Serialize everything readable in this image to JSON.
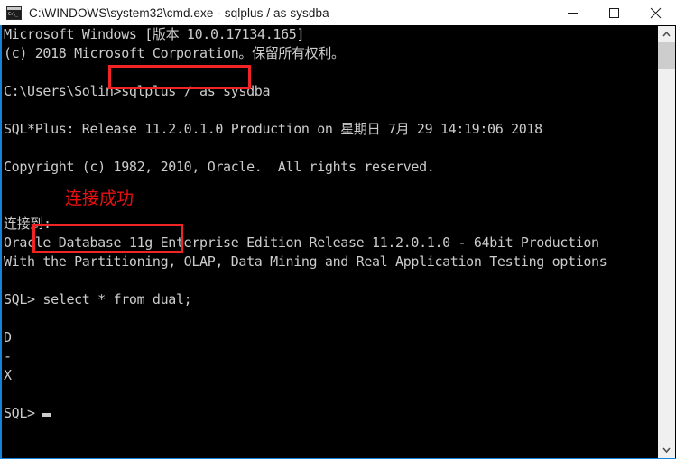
{
  "window": {
    "title": "C:\\WINDOWS\\system32\\cmd.exe - sqlplus  / as sysdba",
    "icon_name": "cmd-exe-icon",
    "icon_glyph": "C:\\_",
    "border_color": "#1683d8",
    "controls": {
      "minimize_label": "Minimize",
      "maximize_label": "Maximize",
      "close_label": "Close"
    }
  },
  "console": {
    "background": "#000000",
    "foreground": "#cccccc",
    "lines": [
      "Microsoft Windows [版本 10.0.17134.165]",
      "(c) 2018 Microsoft Corporation。保留所有权利。",
      "",
      "C:\\Users\\Solin>sqlplus / as sysdba",
      "",
      "SQL*Plus: Release 11.2.0.1.0 Production on 星期日 7月 29 14:19:06 2018",
      "",
      "Copyright (c) 1982, 2010, Oracle.  All rights reserved.",
      "",
      "",
      "连接到:",
      "Oracle Database 11g Enterprise Edition Release 11.2.0.1.0 - 64bit Production",
      "With the Partitioning, OLAP, Data Mining and Real Application Testing options",
      "",
      "SQL> select * from dual;",
      "",
      "D",
      "-",
      "X",
      "",
      "SQL> "
    ],
    "cursor_line_index": 20
  },
  "annotations": {
    "color": "#f02424",
    "success_text": "连接成功",
    "success_color": "#e81010",
    "boxed_command_1": "sqlplus / as sysdba",
    "boxed_command_2": "select * from dual;"
  },
  "scrollbar": {
    "up_arrow": "▲",
    "down_arrow": "▼",
    "thumb_color": "#cdcdcd",
    "track_color": "#f0f0f0"
  }
}
